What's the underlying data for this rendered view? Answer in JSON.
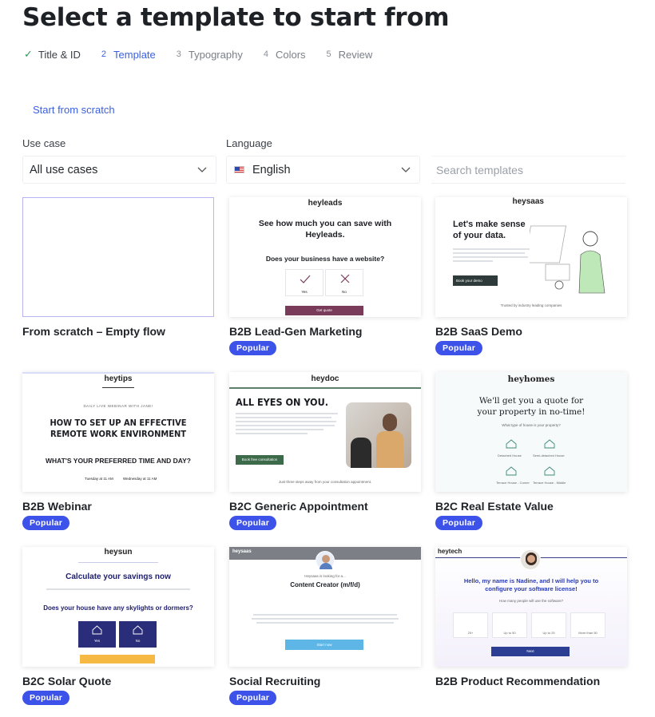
{
  "page": {
    "title": "Select a template to start from"
  },
  "stepper": {
    "steps": [
      {
        "num": "",
        "label": "Title & ID",
        "state": "done"
      },
      {
        "num": "2",
        "label": "Template",
        "state": "active"
      },
      {
        "num": "3",
        "label": "Typography",
        "state": "todo"
      },
      {
        "num": "4",
        "label": "Colors",
        "state": "todo"
      },
      {
        "num": "5",
        "label": "Review",
        "state": "todo"
      }
    ]
  },
  "scratch_link": "Start from scratch",
  "filters": {
    "use_case": {
      "label": "Use case",
      "value": "All use cases"
    },
    "language": {
      "label": "Language",
      "value": "English"
    },
    "search": {
      "placeholder": "Search templates",
      "value": ""
    }
  },
  "badge_label": "Popular",
  "colors": {
    "accent": "#3a5fe0",
    "badge": "#3d52e8",
    "check": "#2d9a5a"
  },
  "templates": [
    {
      "title": "From scratch – Empty flow",
      "popular": false
    },
    {
      "title": "B2B Lead-Gen Marketing",
      "popular": true,
      "preview": {
        "logo": "heyleads",
        "heading": "See how much you can save with Heyleads.",
        "question": "Does your business have a website?",
        "yes": "Yes",
        "no": "No",
        "cta": "Get quote"
      }
    },
    {
      "title": "B2B SaaS Demo",
      "popular": true,
      "preview": {
        "logo": "heysaas",
        "heading": "Let's make sense of your data.",
        "cta": "Book your demo",
        "footer": "Trusted by industry leading companies"
      }
    },
    {
      "title": "B2B Webinar",
      "popular": true,
      "preview": {
        "logo": "heytips",
        "kicker": "DAILY LIVE WEBINAR WITH JANE!",
        "heading": "HOW TO SET UP AN EFFECTIVE REMOTE WORK ENVIRONMENT",
        "question": "WHAT'S YOUR PREFERRED TIME AND DAY?",
        "opt1": "Tuesday at 11 AM",
        "opt2": "Wednesday at 11 AM"
      }
    },
    {
      "title": "B2C Generic Appointment",
      "popular": true,
      "preview": {
        "logo": "heydoc",
        "heading": "ALL EYES ON YOU.",
        "cta": "Book free consultation",
        "footer": "Just three steps away from your consultation appointment."
      }
    },
    {
      "title": "B2C Real Estate Value",
      "popular": true,
      "preview": {
        "logo": "heyhomes",
        "heading": "We'll get you a quote for your property in no-time!",
        "question": "What type of house is your property?",
        "opt1": "Detached House",
        "opt2": "Semi-detached House",
        "opt3": "Terrace House - Corner",
        "opt4": "Terrace House - Middle"
      }
    },
    {
      "title": "B2C Solar Quote",
      "popular": true,
      "preview": {
        "logo": "heysun",
        "heading": "Calculate your savings now",
        "question": "Does your house have any skylights or dormers?",
        "yes": "Yes",
        "no": "No"
      }
    },
    {
      "title": "Social Recruiting",
      "popular": true,
      "preview": {
        "logo": "heysaas",
        "kicker": "Heysaas is looking for a...",
        "heading": "Content Creator (m/f/d)",
        "cta": "Start now"
      }
    },
    {
      "title": "B2B Product Recommendation",
      "popular": false,
      "preview": {
        "logo": "heytech",
        "heading": "Hello, my name is Nadine, and I will help you to configure your software license!",
        "question": "How many people will use the software?",
        "opt1": "25+",
        "opt2": "Up to 50",
        "opt3": "Up to 25",
        "opt4": "More than 50",
        "cta": "Next"
      }
    }
  ]
}
